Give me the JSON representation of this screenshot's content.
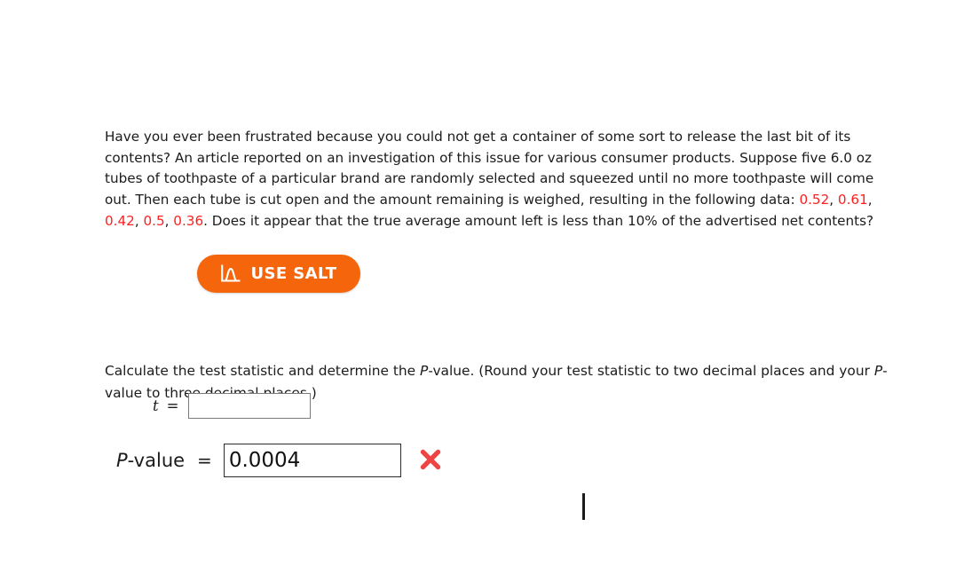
{
  "prompt": {
    "part1": "Have you ever been frustrated because you could not get a container of some sort to release the last bit of its contents? An article reported on an investigation of this issue for various consumer products. Suppose five 6.0 oz tubes of toothpaste of a particular brand are randomly selected and squeezed until no more toothpaste will come out. Then each tube is cut open and the amount remaining is weighed, resulting in the following data: ",
    "data_values": [
      "0.52",
      "0.61",
      "0.42",
      "0.5",
      "0.36"
    ],
    "separator": ", ",
    "terminator": ".",
    "part2": " Does it appear that the true average amount left is less than 10% of the advertised net contents?"
  },
  "salt_button": {
    "label": "USE SALT",
    "icon": "distribution-curve-icon",
    "background_color": "#f4650c",
    "text_color": "#ffffff"
  },
  "instruction": {
    "seg1": "Calculate the test statistic and determine the ",
    "p1": "P",
    "seg2": "-value. (Round your test statistic to two decimal places and your ",
    "p2": "P",
    "seg3": "-value to three decimal places.)"
  },
  "answers": {
    "t_label": "t",
    "t_equals": "=",
    "t_value": "",
    "t_placeholder": "",
    "p_label_italic": "P",
    "p_label_rest": "-value",
    "p_equals": "=",
    "p_value": "0.0004",
    "p_placeholder": "",
    "p_status": "incorrect",
    "p_status_icon": "red-x-icon",
    "p_status_color": "#ef4444"
  },
  "colors": {
    "data_red": "#ff1f1f",
    "accent_orange": "#f4650c",
    "text": "#1b1b1b"
  }
}
